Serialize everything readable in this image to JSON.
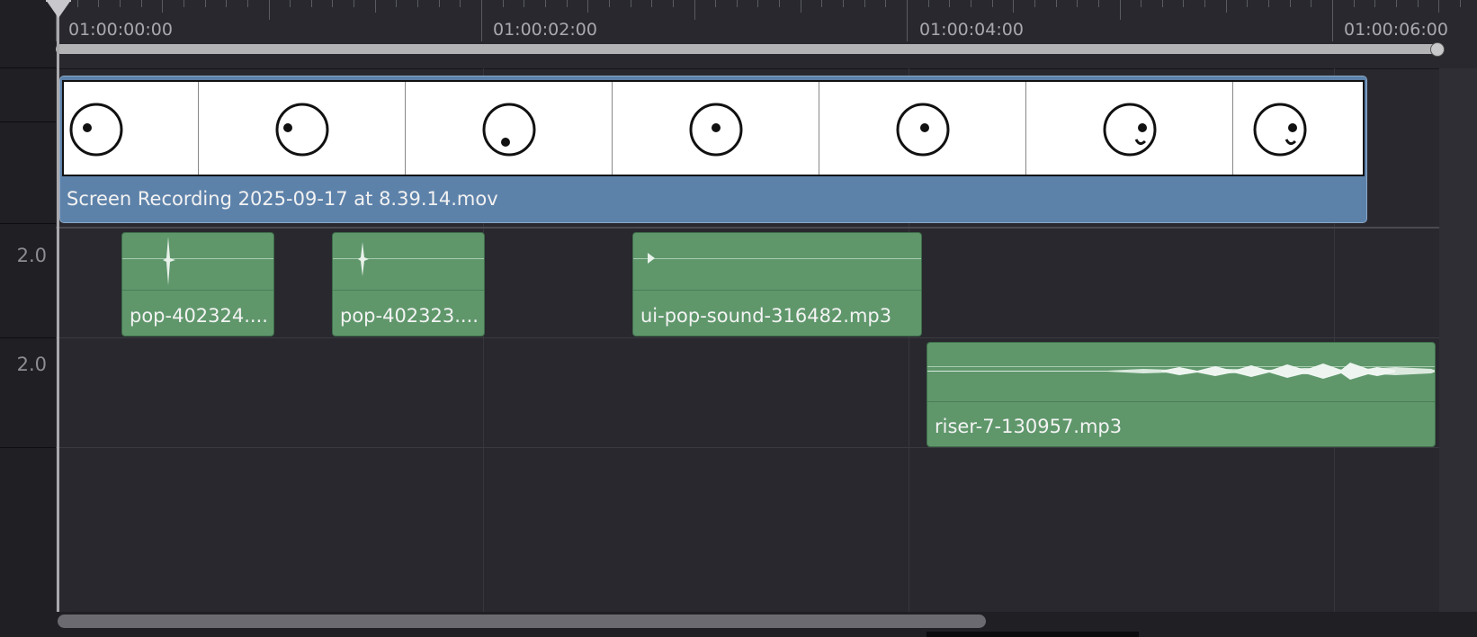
{
  "ruler": {
    "timecodes": [
      "01:00:00:00",
      "01:00:02:00",
      "01:00:04:00",
      "01:00:06:00"
    ]
  },
  "tracks": {
    "audio1_level": "2.0",
    "audio2_level": "2.0"
  },
  "video_clip": {
    "name": "Screen Recording 2025-09-17 at 8.39.14.mov",
    "color": "#5d82aa",
    "thumbnail_count": 7
  },
  "audio_clips": [
    {
      "name": "pop-402324....",
      "color": "#5f976b"
    },
    {
      "name": "pop-402323....",
      "color": "#5f976b"
    },
    {
      "name": "ui-pop-sound-316482.mp3",
      "color": "#5f976b"
    },
    {
      "name": "riser-7-130957.mp3",
      "color": "#5f976b"
    }
  ]
}
